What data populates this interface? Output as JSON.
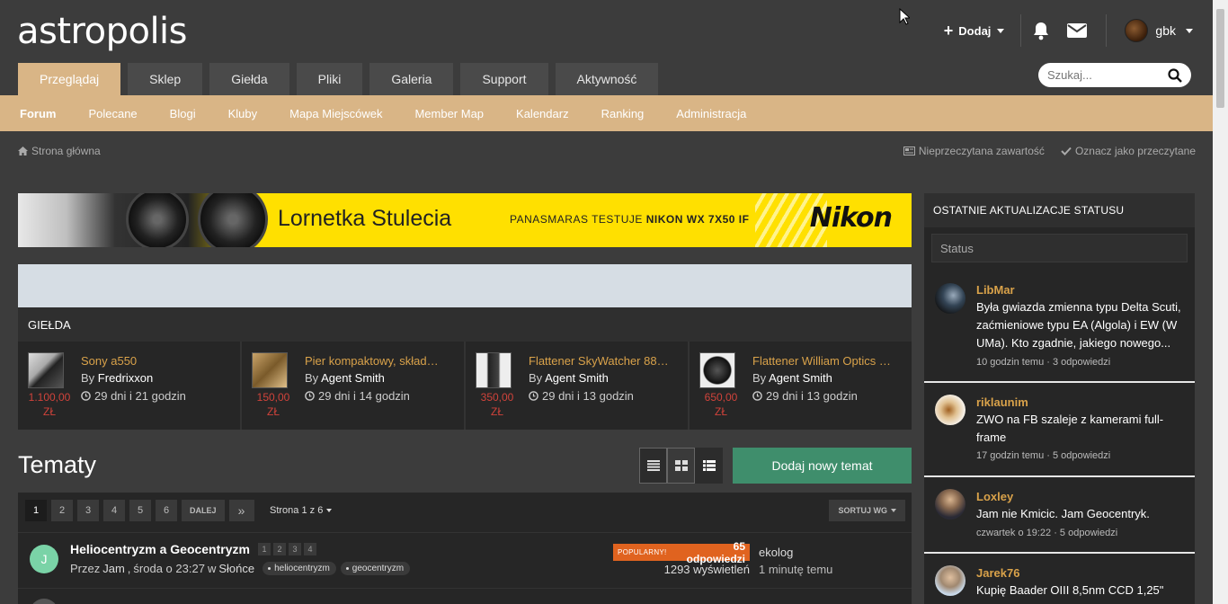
{
  "site": {
    "logo": "astropolis"
  },
  "header": {
    "add_label": "Dodaj",
    "user_name": "gbk",
    "tabs": [
      {
        "label": "Przeglądaj",
        "active": true
      },
      {
        "label": "Sklep"
      },
      {
        "label": "Giełda"
      },
      {
        "label": "Pliki"
      },
      {
        "label": "Galeria"
      },
      {
        "label": "Support"
      },
      {
        "label": "Aktywność"
      }
    ],
    "search_placeholder": "Szukaj..."
  },
  "subnav": [
    "Forum",
    "Polecane",
    "Blogi",
    "Kluby",
    "Mapa Miejscówek",
    "Member Map",
    "Kalendarz",
    "Ranking",
    "Administracja"
  ],
  "breadcrumb": {
    "home": "Strona główna",
    "unread": "Nieprzeczytana zawartość",
    "mark_read": "Oznacz jako przeczytane"
  },
  "banner": {
    "title": "Lornetka Stulecia",
    "tagline_prefix": "PANASMARAS TESTUJE ",
    "tagline_bold": "NIKON WX 7X50 IF",
    "brand": "Nikon"
  },
  "gielda": {
    "heading": "GIEŁDA",
    "items": [
      {
        "title": "Sony a550",
        "by_prefix": "By ",
        "author": "Fredrixxon",
        "time": "29 dni i 21 godzin",
        "price": "1.100,00",
        "currency": "ZŁ"
      },
      {
        "title": "Pier kompaktowy, skład…",
        "by_prefix": "By ",
        "author": "Agent Smith",
        "time": "29 dni i 14 godzin",
        "price": "150,00",
        "currency": "ZŁ"
      },
      {
        "title": "Flattener SkyWatcher 88…",
        "by_prefix": "By ",
        "author": "Agent Smith",
        "time": "29 dni i 13 godzin",
        "price": "350,00",
        "currency": "ZŁ"
      },
      {
        "title": "Flattener William Optics …",
        "by_prefix": "By ",
        "author": "Agent Smith",
        "time": "29 dni i 13 godzin",
        "price": "650,00",
        "currency": "ZŁ"
      }
    ]
  },
  "topics_section": {
    "title": "Tematy",
    "add_topic": "Dodaj nowy temat",
    "pages": [
      "1",
      "2",
      "3",
      "4",
      "5",
      "6"
    ],
    "next": "DALEJ",
    "last": "»",
    "page_of": "Strona 1 z 6",
    "sort": "SORTUJ WG"
  },
  "topic": {
    "avatar_letter": "J",
    "title": "Heliocentryzm a Geocentryzm",
    "mini_pages": [
      "1",
      "2",
      "3",
      "4"
    ],
    "by": "Przez",
    "author": "Jam",
    "date": "środa o 23:27",
    "in": "w",
    "forum": "Słońce",
    "tags": [
      "heliocentryzm",
      "geocentryzm"
    ],
    "popular": "POPULARNY!",
    "replies": "65 odpowiedzi",
    "views": "1293 wyświetleń",
    "last_user": "ekolog",
    "last_time": "1 minutę temu"
  },
  "sidebar": {
    "heading": "OSTATNIE AKTUALIZACJE STATUSU",
    "status_placeholder": "Status",
    "updates": [
      {
        "name": "LibMar",
        "text": "Była gwiazda zmienna typu Delta Scuti, zaćmieniowe typu EA (Algola) i EW (W UMa). Kto zgadnie, jakiego nowego...",
        "meta": "10 godzin temu · 3 odpowiedzi"
      },
      {
        "name": "riklaunim",
        "text": "ZWO na FB szaleje z kamerami full-frame",
        "meta": "17 godzin temu · 5 odpowiedzi"
      },
      {
        "name": "Loxley",
        "text": "Jam nie Kmicic. Jam Geocentryk.",
        "meta": "czwartek o 19:22 · 5 odpowiedzi"
      },
      {
        "name": "Jarek76",
        "text": "Kupię Baader OIII 8,5nm CCD 1,25\"",
        "meta": ""
      }
    ]
  },
  "colors": {
    "accent": "#d9b586",
    "link": "#d9a24a",
    "button": "#3f8e6c",
    "popular": "#e0631f",
    "price": "#d0433b"
  }
}
